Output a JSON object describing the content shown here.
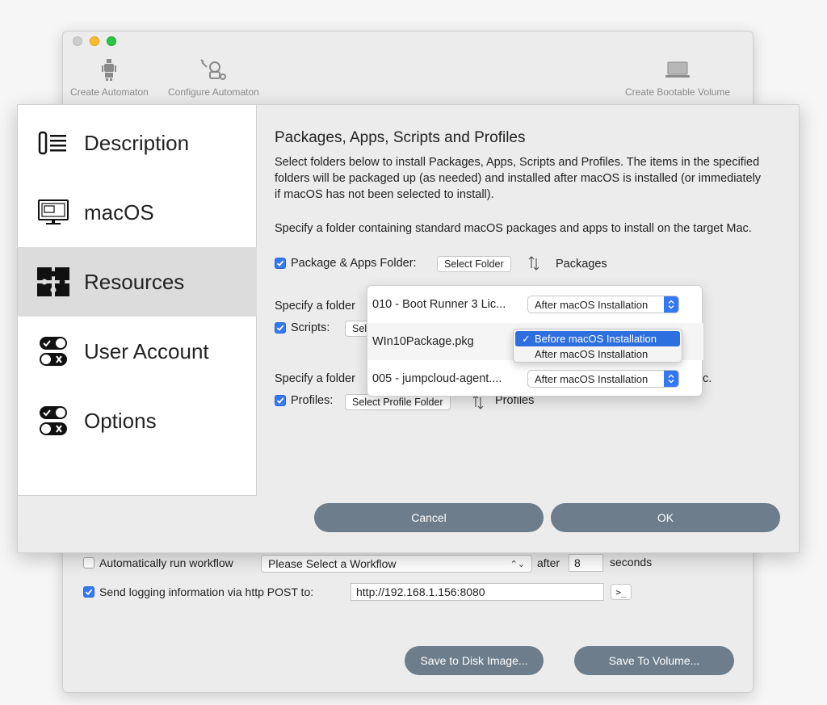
{
  "toolbar": {
    "create_automaton": "Create Automaton",
    "configure_automaton": "Configure Automaton",
    "create_bootable_volume": "Create Bootable Volume"
  },
  "sidebar": {
    "items": [
      {
        "label": "Description",
        "icon": "list-icon"
      },
      {
        "label": "macOS",
        "icon": "monitor-icon"
      },
      {
        "label": "Resources",
        "icon": "puzzle-icon"
      },
      {
        "label": "User Account",
        "icon": "toggles-icon"
      },
      {
        "label": "Options",
        "icon": "toggles-icon"
      }
    ],
    "selected": "Resources"
  },
  "resources": {
    "title": "Packages, Apps, Scripts and Profiles",
    "intro": "Select folders below to install Packages, Apps, Scripts and Profiles. The items in the specified folders will be packaged up (as needed) and installed after macOS is installed (or immediately if macOS has not been selected to install).",
    "packages_desc": "Specify a folder containing standard macOS packages and apps to install on the target Mac.",
    "packages_checkbox": "Package & Apps Folder:",
    "select_folder": "Select Folder",
    "packages_folder": "Packages",
    "scripts_desc": "Specify a folder",
    "scripts_checkbox": "Scripts:",
    "scripts_button": "Sel",
    "profiles_desc": "Specify a folder",
    "profiles_desc_tail": "c.",
    "profiles_checkbox": "Profiles:",
    "select_profile_folder": "Select Profile Folder",
    "profiles_folder": "Profiles"
  },
  "popover": {
    "rows": [
      {
        "name": "010 - Boot Runner 3 Lic...",
        "timing": "After macOS Installation"
      },
      {
        "name": "WIn10Package.pkg",
        "timing": "Before macOS Installation"
      },
      {
        "name": "005 - jumpcloud-agent....",
        "timing": "After macOS Installation"
      }
    ],
    "menu_options": [
      "Before macOS Installation",
      "After macOS Installation"
    ]
  },
  "sheet_buttons": {
    "cancel": "Cancel",
    "ok": "OK"
  },
  "main": {
    "auto_run_label": "Automatically run workflow",
    "workflow_select": "Please Select a Workflow",
    "after_label": "after",
    "seconds_value": "8",
    "seconds_label": "seconds",
    "logging_label": "Send logging information via http POST to:",
    "logging_url": "http://192.168.1.156:8080",
    "save_disk_image": "Save to Disk Image...",
    "save_to_volume": "Save To Volume..."
  },
  "colors": {
    "accent": "#3478f6",
    "pill": "#6d7d8b",
    "selection": "#dcdcdc"
  }
}
